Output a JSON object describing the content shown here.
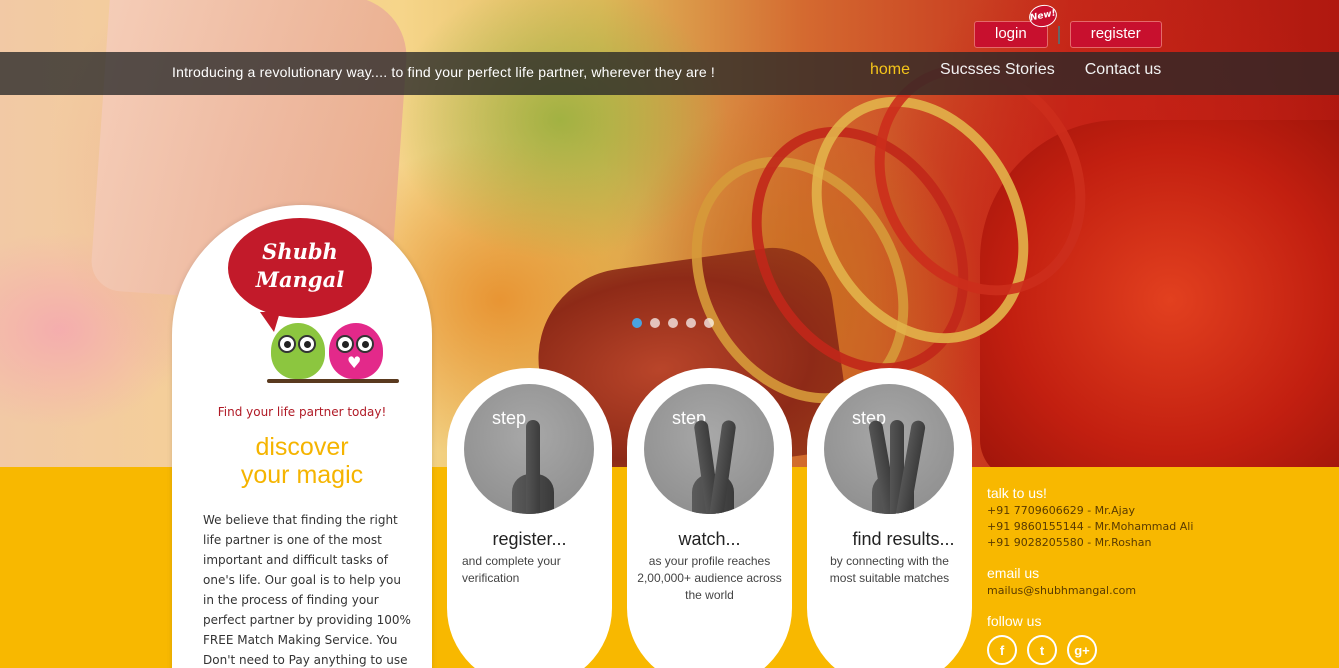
{
  "header": {
    "tagline": "Introducing a revolutionary way.... to find your perfect life partner, wherever they are !",
    "nav": [
      {
        "label": "home",
        "active": true
      },
      {
        "label": "Sucsses Stories",
        "active": false
      },
      {
        "label": "Contact us",
        "active": false
      }
    ],
    "login_label": "login",
    "register_label": "register",
    "new_badge": "New!"
  },
  "hero": {
    "slider_dots": 5,
    "active_dot": 0
  },
  "intro": {
    "logo_line1": "Shubh",
    "logo_line2": "Mangal",
    "tagline": "Find your life partner today!",
    "headline_line1": "discover",
    "headline_line2": "your magic",
    "body": "We believe that finding the right life partner is one of the most important and difficult tasks of one's life. Our goal is to help you in the process of finding your perfect partner by providing 100% FREE Match Making Service. You Don't need to Pay anything to use any"
  },
  "steps": [
    {
      "word": "step",
      "title": "register...",
      "desc": "and complete your verification",
      "icon": "one-finger-hand"
    },
    {
      "word": "step",
      "title": "watch...",
      "desc": "as your profile reaches 2,00,000+ audience across the world",
      "icon": "two-finger-hand"
    },
    {
      "word": "step",
      "title": "find results...",
      "desc": "by connecting with the most suitable matches",
      "icon": "three-finger-hand"
    }
  ],
  "contact": {
    "talk_heading": "talk to us!",
    "phones": [
      "+91 7709606629 - Mr.Ajay",
      "+91 9860155144 - Mr.Mohammad Ali",
      "+91 9028205580 - Mr.Roshan"
    ],
    "email_heading": "email us",
    "email": "mailus@shubhmangal.com",
    "follow_heading": "follow us",
    "social": [
      {
        "name": "facebook-icon",
        "glyph": "f"
      },
      {
        "name": "twitter-icon",
        "glyph": "t"
      },
      {
        "name": "google-plus-icon",
        "glyph": "g+"
      }
    ]
  },
  "colors": {
    "accent_yellow": "#f8b800",
    "brand_red": "#c8102e",
    "nav_active": "#f5c51a"
  }
}
